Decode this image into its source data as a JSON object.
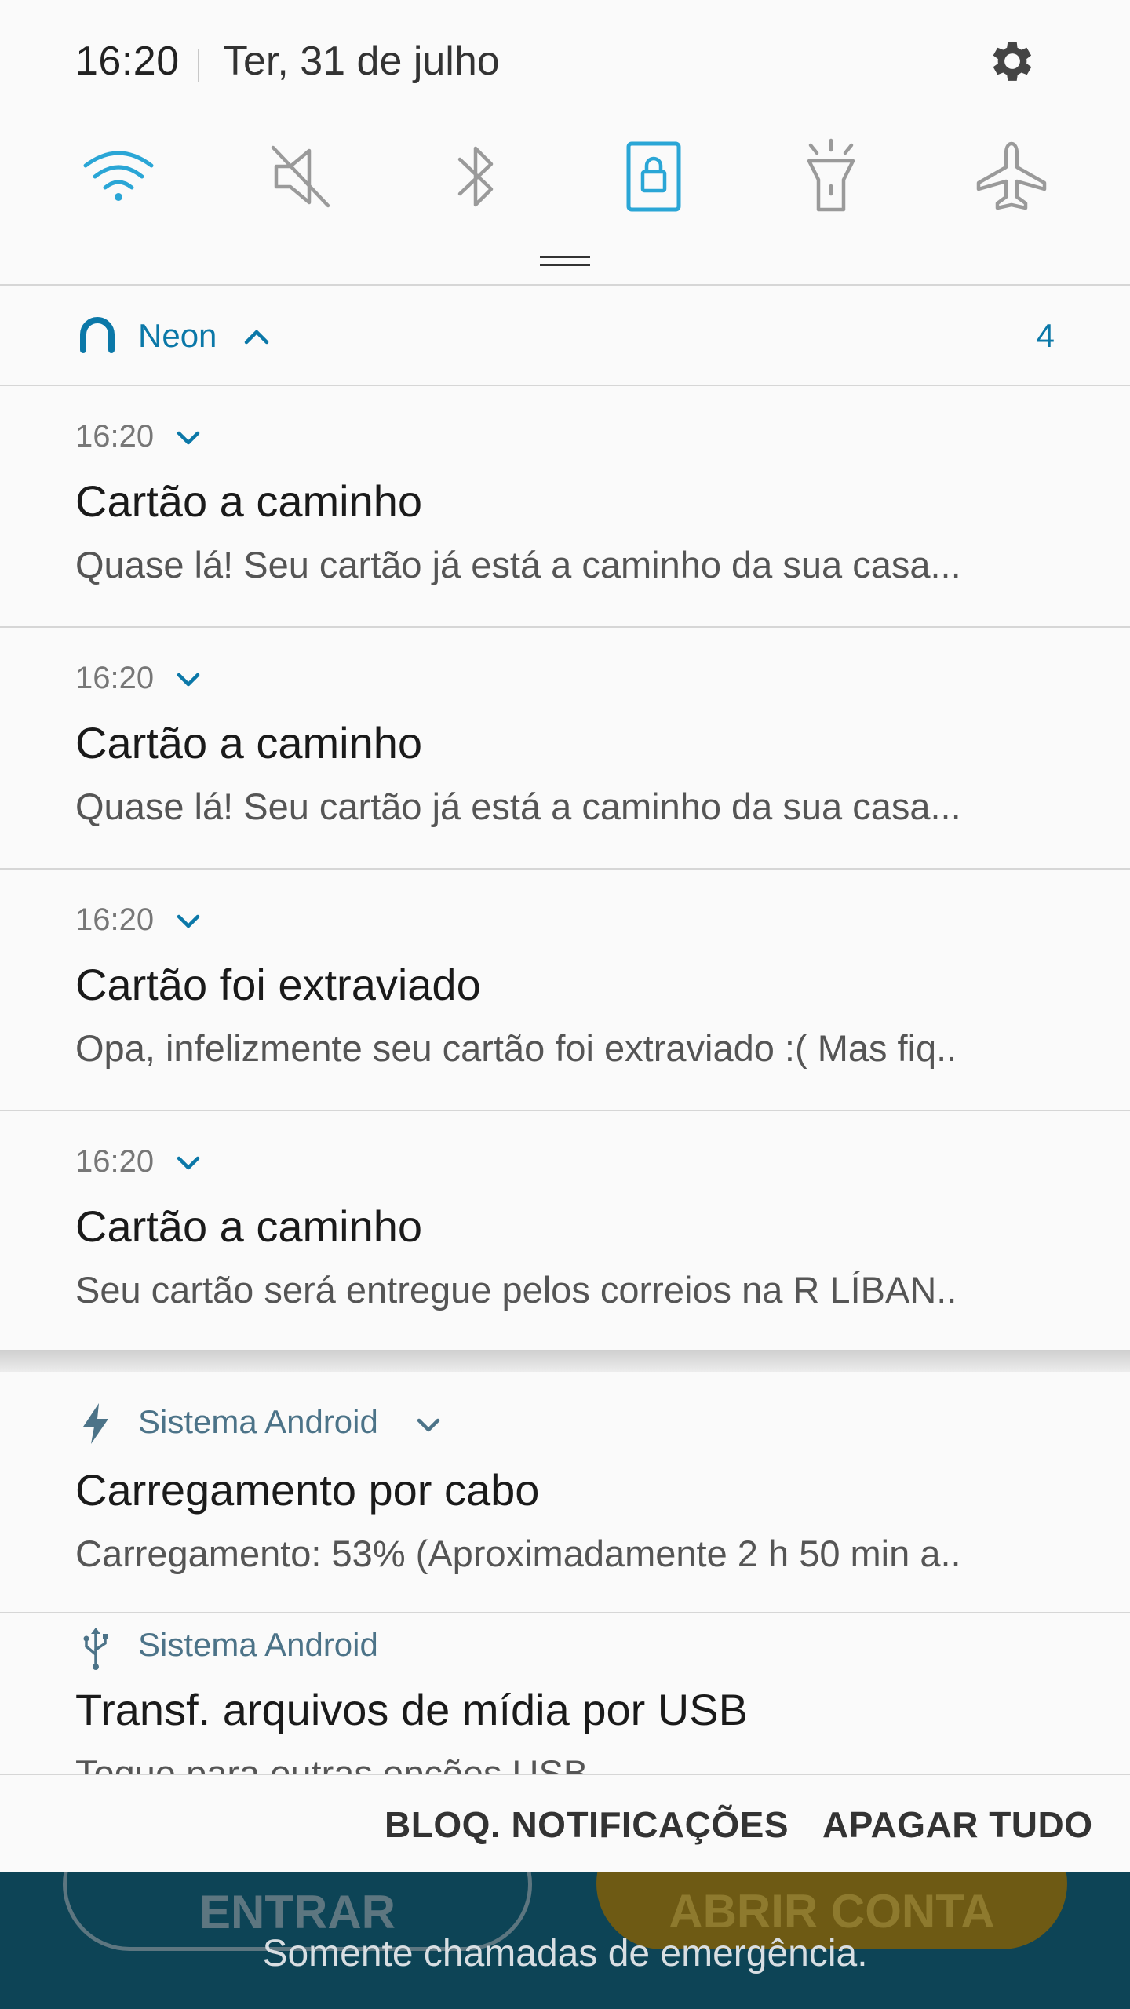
{
  "status": {
    "time": "16:20",
    "date": "Ter, 31 de julho"
  },
  "quick_settings": {
    "toggles": [
      {
        "icon": "wifi-icon",
        "active": true
      },
      {
        "icon": "mute-icon",
        "active": false
      },
      {
        "icon": "bluetooth-icon",
        "active": false
      },
      {
        "icon": "screen-lock-icon",
        "active": true
      },
      {
        "icon": "flashlight-icon",
        "active": false
      },
      {
        "icon": "airplane-icon",
        "active": false
      }
    ]
  },
  "neon_group": {
    "app_name": "Neon",
    "count": "4",
    "notifications": [
      {
        "time": "16:20",
        "title": "Cartão a caminho",
        "body": "Quase lá! Seu cartão já está a caminho da sua casa..."
      },
      {
        "time": "16:20",
        "title": "Cartão a caminho",
        "body": "Quase lá! Seu cartão já está a caminho da sua casa..."
      },
      {
        "time": "16:20",
        "title": "Cartão foi extraviado",
        "body": "Opa, infelizmente seu cartão foi extraviado :( Mas fiq.."
      },
      {
        "time": "16:20",
        "title": "Cartão a caminho",
        "body": "Seu cartão será entregue pelos correios na R LÍBAN.."
      }
    ]
  },
  "system_notifications": [
    {
      "app": "Sistema Android",
      "icon": "charging-bolt-icon",
      "title": "Carregamento por cabo",
      "body": "Carregamento: 53% (Aproximadamente 2 h 50 min a.."
    },
    {
      "app": "Sistema Android",
      "icon": "usb-icon",
      "title": "Transf. arquivos de mídia por USB",
      "body": "Toque para outras opções USB."
    }
  ],
  "actions": {
    "block": "BLOQ. NOTIFICAÇÕES",
    "clear": "APAGAR TUDO"
  },
  "lockscreen": {
    "entrar": "ENTRAR",
    "abrir_conta": "ABRIR CONTA",
    "emergency": "Somente chamadas de emergência."
  },
  "colors": {
    "accent": "#0b78a8",
    "active_toggle": "#2aa6d6",
    "inactive_toggle": "#9a9a9a",
    "lock_bg": "#0d4456"
  }
}
